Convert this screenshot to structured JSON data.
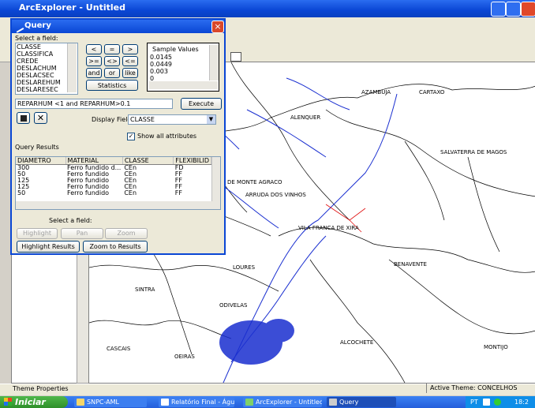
{
  "main_window": {
    "title": "ArcExplorer - Untitled",
    "status_left": "Theme Properties",
    "status_right": "Active Theme: CONCELHOS"
  },
  "map_labels": [
    "AZAMBUJA",
    "CARTAXO",
    "ALENQUER",
    "SALVATERRA DE MAGOS",
    "DE MONTE AGRACO",
    "ARRUDA DOS VINHOS",
    "VILA FRANCA DE XIRA",
    "BENAVENTE",
    "LOURES",
    "SINTRA",
    "ODIVELAS",
    "ALCOCHETE",
    "MONTIJO",
    "CASCAIS",
    "OEIRAS"
  ],
  "query": {
    "title": "Query",
    "select_field_label": "Select a field:",
    "fields": [
      "CLASSE",
      "CLASSIFICA",
      "CREDE",
      "DESLACHUM",
      "DESLACSEC",
      "DESLAREHUM",
      "DESLARESEC"
    ],
    "operators": [
      "<",
      "=",
      ">",
      ">=",
      "<>",
      "<=",
      "and",
      "or",
      "like"
    ],
    "statistics_label": "Statistics",
    "sample_values_label": "Sample Values",
    "sample_values": [
      "0.0145",
      "0.0449",
      "0.003",
      "0"
    ],
    "expression": "REPARHUM <1 and REPARHUM>0.1",
    "execute_label": "Execute",
    "display_field_label": "Display Field:",
    "display_field_value": "CLASSE",
    "show_all_attributes_label": "Show all attributes",
    "show_all_attributes_checked": true,
    "results_label": "Query Results",
    "columns": [
      "DIAMETRO",
      "MATERIAL",
      "CLASSE",
      "FLEXIBILID"
    ],
    "rows": [
      [
        "300",
        "Ferro fundido d...",
        "CEn",
        "FD"
      ],
      [
        "50",
        "Ferro fundido",
        "CEn",
        "FF"
      ],
      [
        "125",
        "Ferro fundido",
        "CEn",
        "FF"
      ],
      [
        "125",
        "Ferro fundido",
        "CEn",
        "FF"
      ],
      [
        "50",
        "Ferro fundido",
        "CEn",
        "FF"
      ]
    ],
    "select_field_label2": "Select a field:",
    "highlight_label": "Highlight",
    "pan_label": "Pan",
    "zoom_label": "Zoom",
    "highlight_results_label": "Highlight Results",
    "zoom_to_results_label": "Zoom to Results"
  },
  "taskbar": {
    "start_label": "Iniciar",
    "tasks": [
      "SNPC-AML",
      "Relatório Final - Água...",
      "ArcExplorer - Untitled",
      "Query"
    ],
    "language": "PT",
    "clock": "18:2"
  },
  "colors": {
    "titlebar": "#0a46d4",
    "network": "#1a2fd0",
    "boundary": "#000000"
  }
}
